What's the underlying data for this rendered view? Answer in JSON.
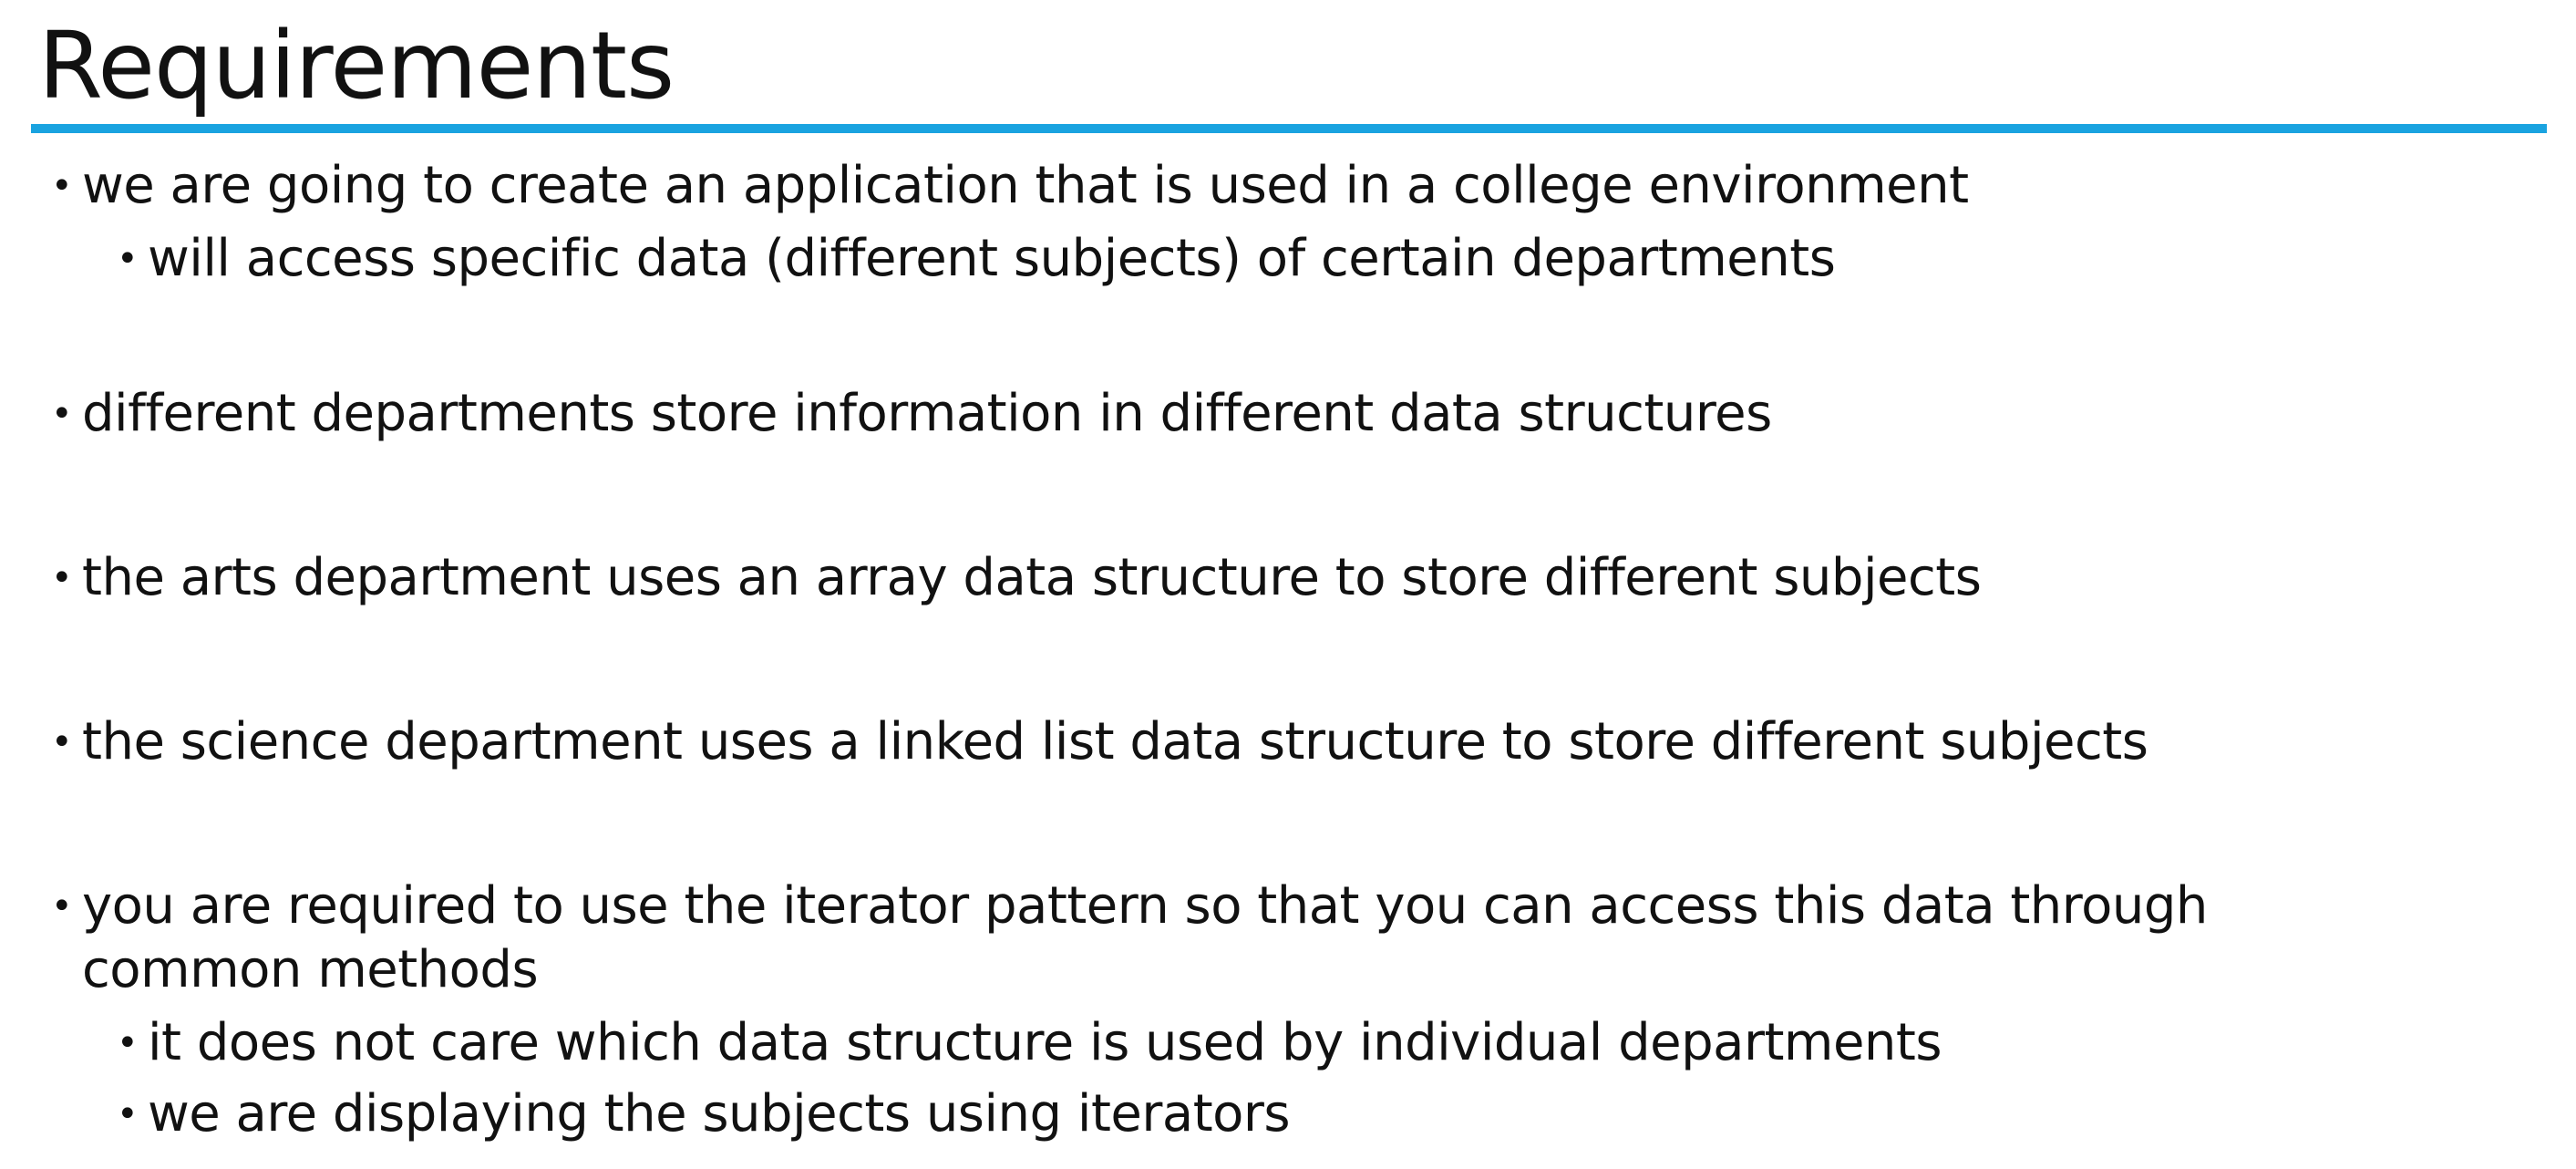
{
  "title": "Requirements",
  "bullets": [
    {
      "level": 1,
      "text": "we are going to create an application that is used in a college environment"
    },
    {
      "level": 2,
      "text": "will access specific data (different subjects) of certain departments"
    },
    {
      "level": 1,
      "text": "different departments store information in different data structures"
    },
    {
      "level": 1,
      "text": "the arts department uses an array data structure to store different subjects"
    },
    {
      "level": 1,
      "text": "the science department uses a linked list data structure to store different subjects"
    },
    {
      "level": 1,
      "text_line1": "you are required to use the iterator pattern so that you can access this data through",
      "text_line2": "common methods"
    },
    {
      "level": 2,
      "text": "it does not care which data structure is used by individual departments"
    },
    {
      "level": 2,
      "text": "we are displaying the subjects using iterators"
    }
  ],
  "colors": {
    "accent_rule": "#1aa3e0",
    "text": "#111111",
    "background": "#ffffff"
  }
}
